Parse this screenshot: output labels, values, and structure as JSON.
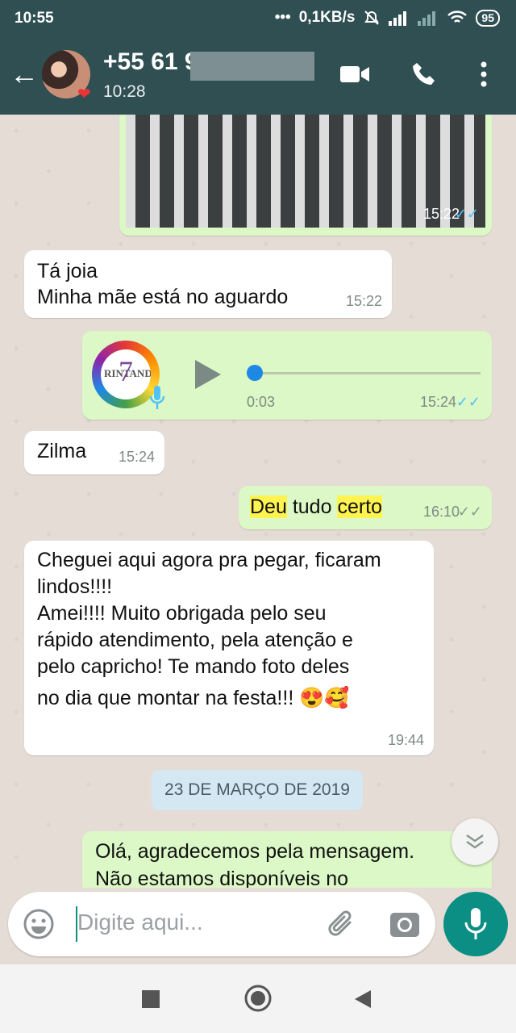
{
  "status": {
    "time": "10:55",
    "dots": "•••",
    "net": "0,1KB/s",
    "battery": "95"
  },
  "header": {
    "contact": "+55 61 9",
    "last_seen": "10:28"
  },
  "messages": {
    "img_time": "15:22",
    "m1_line1": "Tá joia",
    "m1_line2": "Minha mãe está no aguardo",
    "m1_time": "15:22",
    "audio_avatar_text": "RINTAND",
    "audio_avatar_num": "7",
    "audio_duration": "0:03",
    "audio_time": "15:24",
    "m2": "Zilma",
    "m2_time": "15:24",
    "m3_w1": "Deu",
    "m3_w2": " tudo ",
    "m3_w3": "certo",
    "m3_time": "16:10",
    "m4_l1": "Cheguei aqui agora pra pegar, ficaram",
    "m4_l2": "lindos!!!!",
    "m4_l3": "Amei!!!! Muito obrigada pelo seu",
    "m4_l4": "rápido atendimento, pela atenção e",
    "m4_l5": "pelo capricho! Te mando foto deles",
    "m4_l6": "no dia que montar na festa!!! 😍🥰",
    "m4_time": "19:44",
    "date_chip": "23 DE MARÇO DE 2019",
    "m5_l1": "Olá, agradecemos pela mensagem.",
    "m5_l2": "Não estamos disponíveis no"
  },
  "composer": {
    "placeholder": "Digite aqui..."
  },
  "icons": [
    "back-arrow-icon",
    "video-call-icon",
    "phone-icon",
    "more-icon",
    "emoji-icon",
    "attach-icon",
    "camera-icon",
    "mic-icon",
    "chevron-down-icon",
    "play-icon"
  ],
  "colors": {
    "header": "#2f4f53",
    "outgoing": "#dcf8c6",
    "incoming": "#ffffff",
    "accent": "#0b8f84",
    "read_ticks": "#4fc3f7"
  }
}
